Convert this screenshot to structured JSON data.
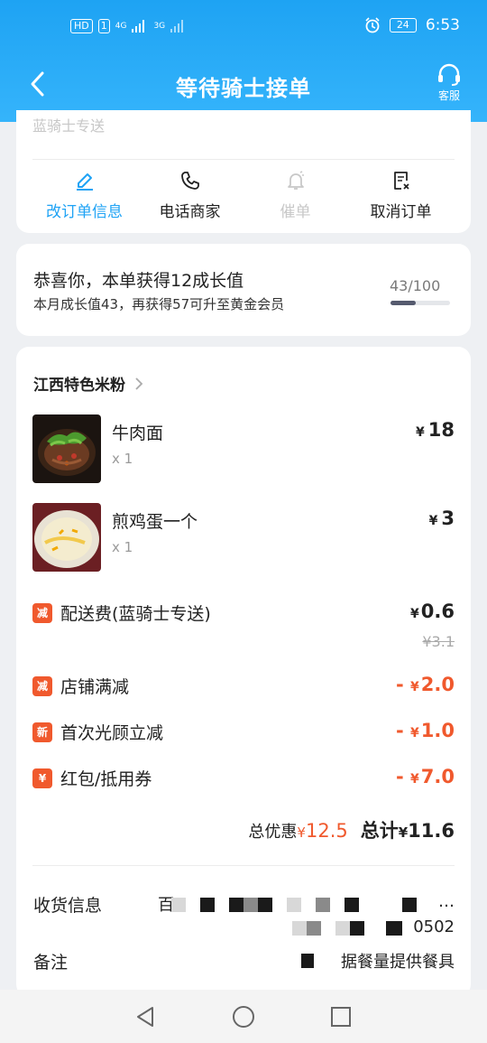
{
  "status_bar": {
    "left_pill": "HD",
    "net1": "4G",
    "net2": "3G",
    "battery": "24",
    "time": "6:53"
  },
  "header": {
    "title": "等待骑士接单",
    "service_label": "客服"
  },
  "cut_text": "蓝骑士专送",
  "actions": [
    {
      "label": "改订单信息",
      "icon": "edit-icon",
      "state": "active"
    },
    {
      "label": "电话商家",
      "icon": "phone-icon",
      "state": "normal"
    },
    {
      "label": "催单",
      "icon": "bell-icon",
      "state": "disabled"
    },
    {
      "label": "取消订单",
      "icon": "cancel-order-icon",
      "state": "normal"
    }
  ],
  "growth": {
    "title": "恭喜你，本单获得12成长值",
    "subtitle": "本月成长值43，再获得57可升至黄金会员",
    "count": "43/100",
    "progress": 0.43
  },
  "order": {
    "shop_name": "江西特色米粉",
    "currency": "¥",
    "items": [
      {
        "name": "牛肉面",
        "qty": "x 1",
        "price": "18"
      },
      {
        "name": "煎鸡蛋一个",
        "qty": "x 1",
        "price": "3"
      }
    ],
    "delivery": {
      "tag": "减",
      "label": "配送费(蓝骑士专送)",
      "value": "0.6",
      "original": "¥3.1"
    },
    "discounts": [
      {
        "tag": "减",
        "label": "店铺满减",
        "value": "2.0",
        "prefix": "-"
      },
      {
        "tag": "新",
        "label": "首次光顾立减",
        "value": "1.0",
        "prefix": "-"
      },
      {
        "tag": "¥",
        "label": "红包/抵用券",
        "value": "7.0",
        "prefix": "-"
      }
    ],
    "discount_total_label": "总优惠",
    "discount_total": "12.5",
    "total_label": "总计",
    "total": "11.6"
  },
  "receiver": {
    "label": "收货信息",
    "line1_start": "百",
    "line1_end": "…",
    "line2_end": "0502"
  },
  "remark": {
    "label": "备注",
    "value": "据餐量提供餐具"
  },
  "colors": {
    "brand": "#1fa3f5",
    "accent_red": "#f0592d"
  }
}
